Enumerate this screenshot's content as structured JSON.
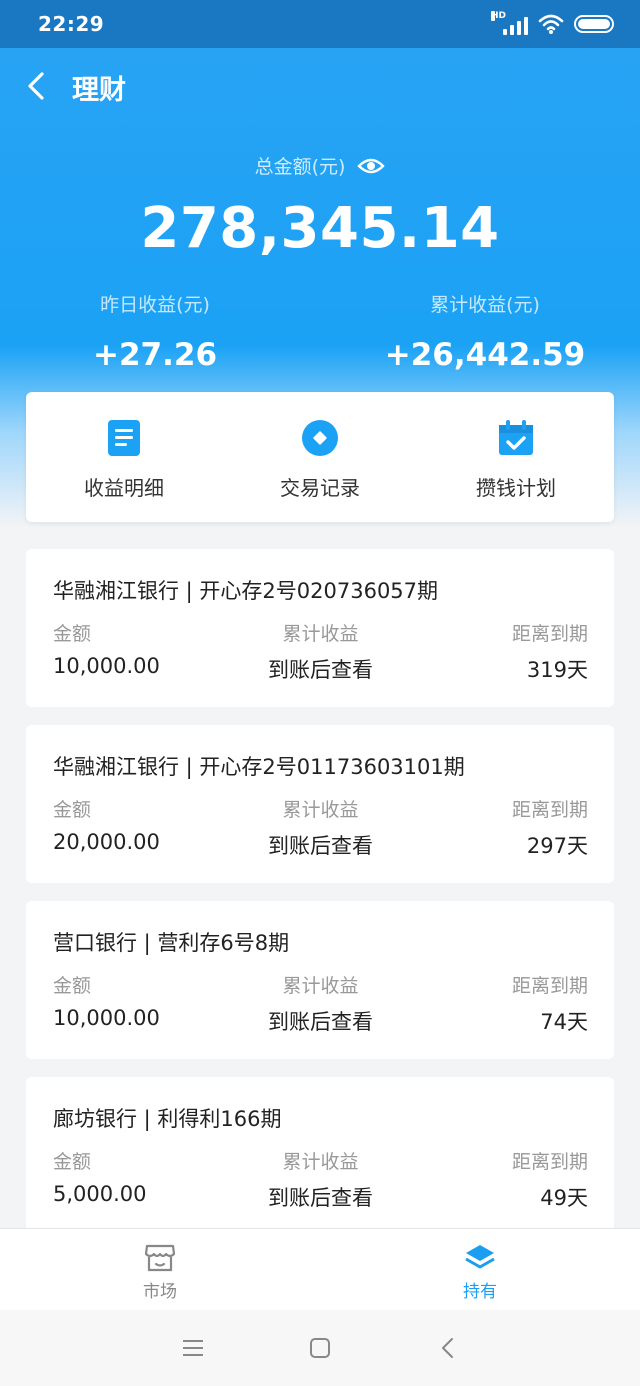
{
  "status_bar": {
    "time": "22:29",
    "network": "HD"
  },
  "header": {
    "title": "理财"
  },
  "summary": {
    "total_label": "总金额(元)",
    "total_amount": "278,345.14",
    "yesterday_label": "昨日收益(元)",
    "yesterday_value": "+27.26",
    "cumulative_label": "累计收益(元)",
    "cumulative_value": "+26,442.59"
  },
  "quick_actions": [
    {
      "label": "收益明细",
      "icon": "document-icon"
    },
    {
      "label": "交易记录",
      "icon": "record-icon"
    },
    {
      "label": "攒钱计划",
      "icon": "calendar-check-icon"
    }
  ],
  "column_labels": {
    "amount": "金额",
    "earnings": "累计收益",
    "maturity": "距离到期"
  },
  "holdings": [
    {
      "title": "华融湘江银行 | 开心存2号020736057期",
      "amount": "10,000.00",
      "earnings": "到账后查看",
      "maturity": "319天"
    },
    {
      "title": "华融湘江银行 | 开心存2号01173603101期",
      "amount": "20,000.00",
      "earnings": "到账后查看",
      "maturity": "297天"
    },
    {
      "title": "营口银行 | 营利存6号8期",
      "amount": "10,000.00",
      "earnings": "到账后查看",
      "maturity": "74天"
    },
    {
      "title": "廊坊银行 | 利得利166期",
      "amount": "5,000.00",
      "earnings": "到账后查看",
      "maturity": "49天"
    }
  ],
  "tabs": [
    {
      "label": "市场",
      "icon": "store-icon",
      "active": false
    },
    {
      "label": "持有",
      "icon": "layers-icon",
      "active": true
    }
  ],
  "colors": {
    "primary": "#1ba2f5",
    "status_bar": "#1a78c2",
    "background": "#f3f4f6"
  }
}
